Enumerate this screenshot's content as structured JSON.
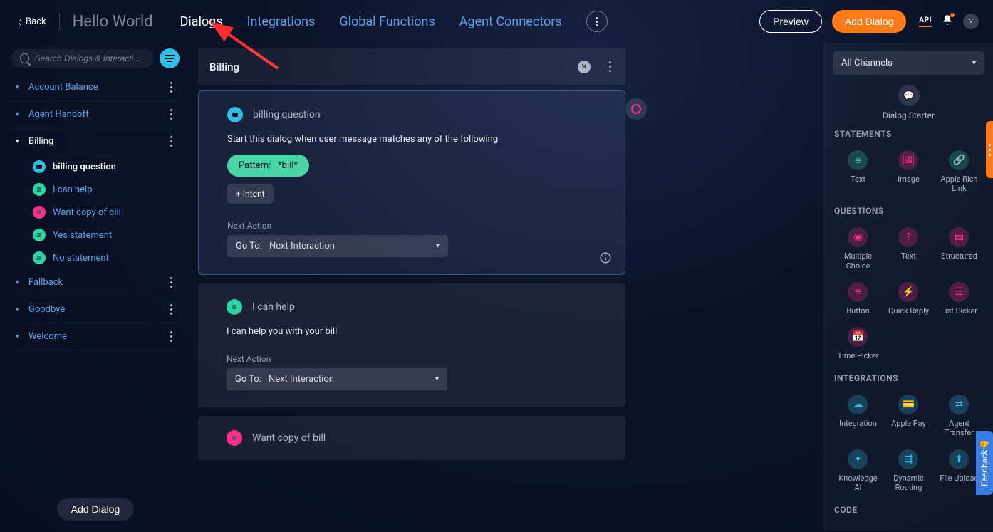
{
  "header": {
    "back": "Back",
    "title": "Hello World",
    "tabs": {
      "dialogs": "Dialogs",
      "integrations": "Integrations",
      "globalFunctions": "Global Functions",
      "agentConnectors": "Agent Connectors"
    },
    "preview": "Preview",
    "addDialog": "Add Dialog",
    "apiLabel": "API"
  },
  "search": {
    "placeholder": "Search Dialogs & Interacti..."
  },
  "tree": {
    "accountBalance": "Account Balance",
    "agentHandoff": "Agent Handoff",
    "billing": "Billing",
    "billing_items": {
      "billingQuestion": "billing question",
      "iCanHelp": "I can help",
      "wantCopy": "Want copy of bill",
      "yes": "Yes statement",
      "no": "No statement"
    },
    "fallback": "Fallback",
    "goodbye": "Goodbye",
    "welcome": "Welcome"
  },
  "leftFooter": {
    "addDialog": "Add Dialog"
  },
  "dialog": {
    "title": "Billing",
    "card1": {
      "title": "billing question",
      "desc": "Start this dialog when user message matches any of the following",
      "patternLabel": "Pattern:",
      "patternValue": "*bill*",
      "intentBtn": "+ Intent",
      "nextAction": "Next Action",
      "goTo": "Go To:",
      "goToValue": "Next Interaction"
    },
    "card2": {
      "title": "I can help",
      "text": "I can help you with your bill",
      "nextAction": "Next Action",
      "goTo": "Go To:",
      "goToValue": "Next Interaction"
    },
    "card3": {
      "title": "Want copy of bill"
    }
  },
  "right": {
    "channels": "All Channels",
    "starter": "Dialog Starter",
    "sections": {
      "statements": "STATEMENTS",
      "questions": "QUESTIONS",
      "integrations": "INTEGRATIONS",
      "code": "CODE"
    },
    "tiles": {
      "text": "Text",
      "image": "Image",
      "appleRichLink": "Apple Rich Link",
      "multipleChoice": "Multiple Choice",
      "textQ": "Text",
      "structured": "Structured",
      "button": "Button",
      "quickReply": "Quick Reply",
      "listPicker": "List Picker",
      "timePicker": "Time Picker",
      "integration": "Integration",
      "applePay": "Apple Pay",
      "agentTransfer": "Agent Transfer",
      "knowledgeAI": "Knowledge AI",
      "dynamicRouting": "Dynamic Routing",
      "fileUpload": "File Upload"
    }
  },
  "feedback": "Feedback"
}
